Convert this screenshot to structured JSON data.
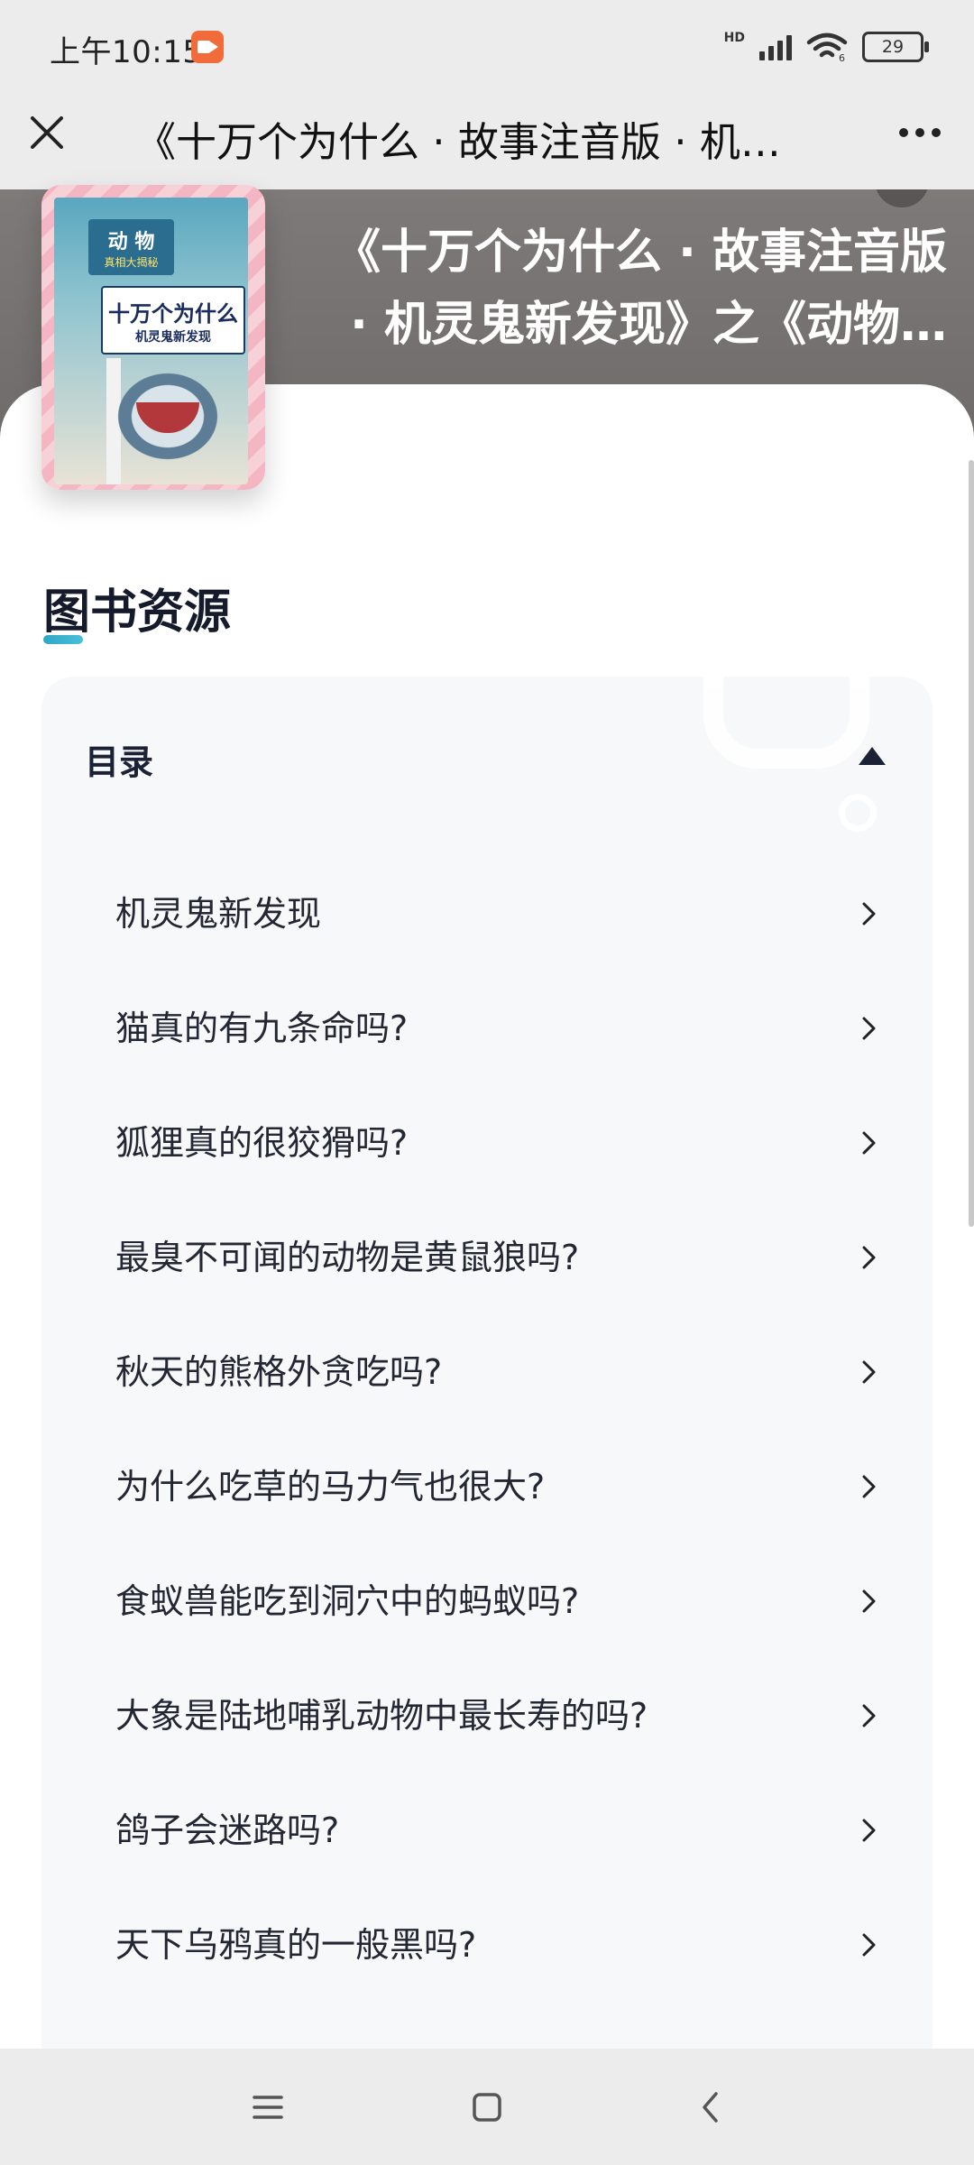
{
  "status_bar": {
    "time": "上午10:15",
    "network_label": "HD",
    "wifi_label": "6",
    "battery_level": "29"
  },
  "header": {
    "title": "《十万个为什么 · 故事注音版 · 机灵…"
  },
  "hero": {
    "title": "《十万个为什么 · 故事注音版 · 机灵鬼新发现》之《动物…"
  },
  "book_cover": {
    "badge_title": "动 物",
    "badge_sub": "真相大揭秘",
    "series_title": "十万个为什么",
    "series_sub": "机灵鬼新发现"
  },
  "section": {
    "title": "图书资源"
  },
  "toc": {
    "heading": "目录",
    "items": [
      {
        "label": "机灵鬼新发现"
      },
      {
        "label": "猫真的有九条命吗?"
      },
      {
        "label": "狐狸真的很狡猾吗?"
      },
      {
        "label": "最臭不可闻的动物是黄鼠狼吗?"
      },
      {
        "label": "秋天的熊格外贪吃吗?"
      },
      {
        "label": "为什么吃草的马力气也很大?"
      },
      {
        "label": "食蚁兽能吃到洞穴中的蚂蚁吗?"
      },
      {
        "label": "大象是陆地哺乳动物中最长寿的吗?"
      },
      {
        "label": "鸽子会迷路吗?"
      },
      {
        "label": "天下乌鸦真的一般黑吗?"
      }
    ]
  },
  "colors": {
    "accent": "#2fa6c4",
    "status_rec": "#f26b3a",
    "hero_bg": "#7e7a79",
    "toc_bg": "#f7f8f9"
  }
}
